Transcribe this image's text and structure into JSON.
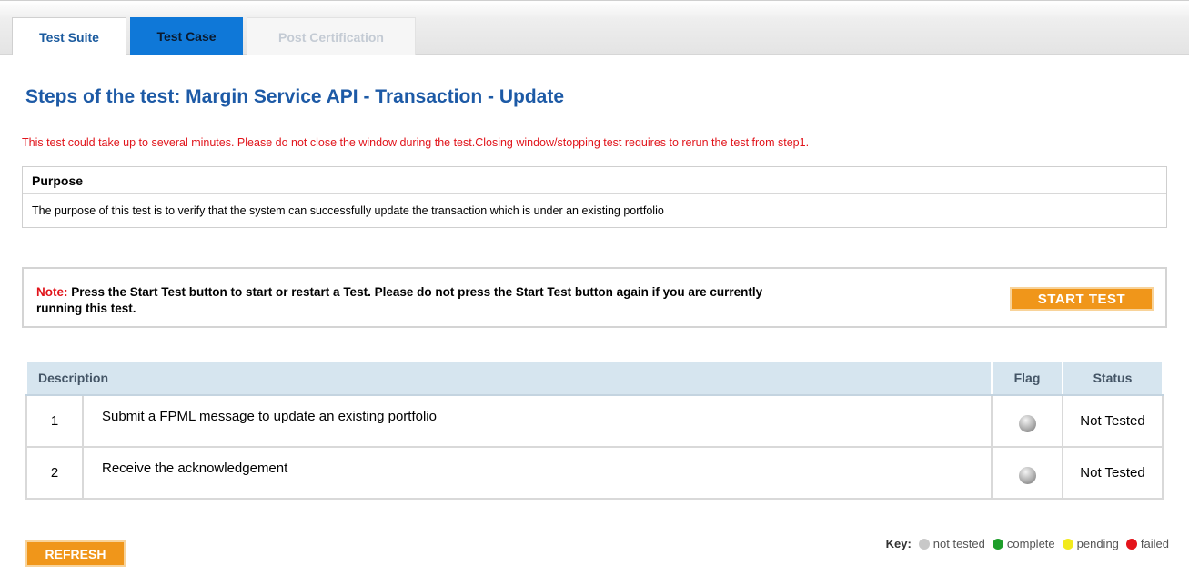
{
  "tabs": [
    {
      "label": "Test Suite"
    },
    {
      "label": "Test Case"
    },
    {
      "label": "Post Certification"
    }
  ],
  "page_title": "Steps of the test: Margin Service API - Transaction - Update",
  "warning": "This test could take up to several minutes. Please do not close the window during the test.Closing window/stopping test requires to rerun the test from step1.",
  "purpose": {
    "heading": "Purpose",
    "text": "The purpose of this test is to verify that the system can successfully update the transaction which is under an existing portfolio"
  },
  "note": {
    "label": "Note:",
    "text": " Press the Start Test button to start or restart a Test. Please do not press the Start Test button again if you are currently running this test.",
    "start_button": "START TEST"
  },
  "table": {
    "headers": {
      "description": "Description",
      "flag": "Flag",
      "status": "Status"
    },
    "rows": [
      {
        "num": "1",
        "description": "Submit a FPML message to update an existing portfolio",
        "flag": "not-tested-icon",
        "status": "Not Tested"
      },
      {
        "num": "2",
        "description": "Receive the acknowledgement",
        "flag": "not-tested-icon",
        "status": "Not Tested"
      }
    ]
  },
  "key": {
    "label": "Key:",
    "items": [
      {
        "label": "not tested",
        "color": "#c8c8c8"
      },
      {
        "label": "complete",
        "color": "#1e9e2a"
      },
      {
        "label": "pending",
        "color": "#f2ea1c"
      },
      {
        "label": "failed",
        "color": "#e4141b"
      }
    ]
  },
  "refresh_button": "REFRESH"
}
